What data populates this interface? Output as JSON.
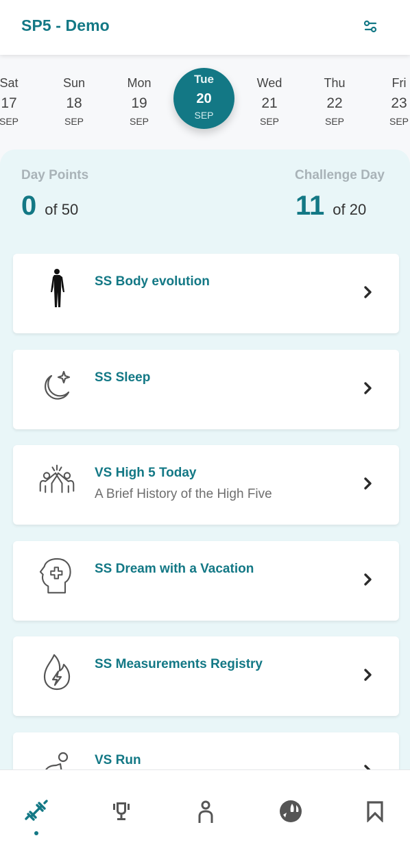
{
  "header": {
    "title": "SP5 - Demo",
    "filter_icon": "sliders-icon"
  },
  "colors": {
    "accent": "#137885",
    "background": "#f7f8fa",
    "content_bg": "#e9f6f8",
    "label_gray": "#a9b3b8"
  },
  "dates": [
    {
      "dow": "Sat",
      "num": "17",
      "mon": "SEP",
      "selected": false
    },
    {
      "dow": "Sun",
      "num": "18",
      "mon": "SEP",
      "selected": false
    },
    {
      "dow": "Mon",
      "num": "19",
      "mon": "SEP",
      "selected": false
    },
    {
      "dow": "Tue",
      "num": "20",
      "mon": "SEP",
      "selected": true
    },
    {
      "dow": "Wed",
      "num": "21",
      "mon": "SEP",
      "selected": false
    },
    {
      "dow": "Thu",
      "num": "22",
      "mon": "SEP",
      "selected": false
    },
    {
      "dow": "Fri",
      "num": "23",
      "mon": "SEP",
      "selected": false
    }
  ],
  "stats": {
    "day_points": {
      "label": "Day Points",
      "value": "0",
      "of": "of 50"
    },
    "challenge_day": {
      "label": "Challenge Day",
      "value": "11",
      "of": "of 20"
    }
  },
  "activities": [
    {
      "title": "SS Body evolution",
      "subtitle": "",
      "icon": "human-body-icon"
    },
    {
      "title": "SS Sleep",
      "subtitle": "",
      "icon": "moon-star-icon"
    },
    {
      "title": "VS High 5 Today",
      "subtitle": "A Brief History of the High Five",
      "icon": "high-five-icon"
    },
    {
      "title": "SS Dream with a Vacation",
      "subtitle": "",
      "icon": "head-plus-icon"
    },
    {
      "title": "SS Measurements Registry",
      "subtitle": "",
      "icon": "flame-bolt-icon"
    },
    {
      "title": "VS Run",
      "subtitle": "",
      "icon": "runner-icon"
    }
  ],
  "bottom_nav": [
    {
      "name": "workouts",
      "icon": "dumbbell-icon",
      "active": true
    },
    {
      "name": "challenges",
      "icon": "trophy-icon",
      "active": false
    },
    {
      "name": "profile",
      "icon": "person-icon",
      "active": false
    },
    {
      "name": "explore",
      "icon": "globe-icon",
      "active": false
    },
    {
      "name": "saved",
      "icon": "bookmark-icon",
      "active": false
    }
  ]
}
